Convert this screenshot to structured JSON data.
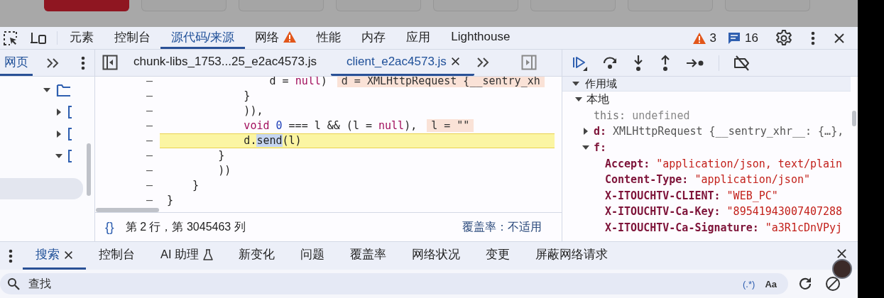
{
  "page_tabs": [
    {
      "selected": true
    },
    {
      "selected": false
    },
    {
      "selected": false
    },
    {
      "selected": false
    },
    {
      "selected": false
    },
    {
      "selected": false
    },
    {
      "selected": false
    },
    {
      "selected": false
    }
  ],
  "main_tabs": [
    {
      "label": "元素",
      "selected": false,
      "warning": false
    },
    {
      "label": "控制台",
      "selected": false,
      "warning": false
    },
    {
      "label": "源代码/来源",
      "selected": true,
      "warning": false
    },
    {
      "label": "网络",
      "selected": false,
      "warning": true
    },
    {
      "label": "性能",
      "selected": false,
      "warning": false
    },
    {
      "label": "内存",
      "selected": false,
      "warning": false
    },
    {
      "label": "应用",
      "selected": false,
      "warning": false
    },
    {
      "label": "Lighthouse",
      "selected": false,
      "warning": false
    }
  ],
  "issues": {
    "warnings": "3",
    "messages": "16"
  },
  "navigator": {
    "tabs": [
      {
        "label": "网页",
        "selected": true
      }
    ],
    "items": [
      {
        "kind": "folder",
        "expanded": true,
        "selected": false
      },
      {
        "kind": "frame",
        "expanded": false,
        "selected": false
      },
      {
        "kind": "frame",
        "expanded": false,
        "selected": false
      },
      {
        "kind": "frame",
        "expanded": true,
        "selected": false
      },
      {
        "kind": "blank",
        "selected": true
      }
    ]
  },
  "editor": {
    "tabs": [
      {
        "label": "chunk-libs_1753...25_e2ac4573.js",
        "selected": false,
        "closable": false
      },
      {
        "label": "client_e2ac4573.js",
        "selected": true,
        "closable": true
      }
    ],
    "lines": [
      {
        "gutter": "–",
        "paused": false,
        "tokens": [
          {
            "text": "                d = ",
            "kind": "plain"
          },
          {
            "text": "null",
            "kind": "keyword"
          },
          {
            "text": ")",
            "kind": "plain"
          }
        ],
        "inline_value": "d = XMLHttpRequest {__sentry_xh"
      },
      {
        "gutter": "–",
        "paused": false,
        "tokens": [
          {
            "text": "            }",
            "kind": "plain"
          }
        ]
      },
      {
        "gutter": "–",
        "paused": false,
        "tokens": [
          {
            "text": "            )),",
            "kind": "plain"
          }
        ]
      },
      {
        "gutter": "–",
        "paused": false,
        "tokens": [
          {
            "text": "            void",
            "kind": "keyword"
          },
          {
            "text": " 0",
            "kind": "number"
          },
          {
            "text": " === l && (l = ",
            "kind": "plain"
          },
          {
            "text": "null",
            "kind": "keyword"
          },
          {
            "text": "),",
            "kind": "plain"
          }
        ],
        "inline_value": "l = \"\""
      },
      {
        "gutter": "–",
        "paused": true,
        "tokens": [
          {
            "text": "            d.",
            "kind": "plain"
          },
          {
            "text": "send",
            "kind": "selection"
          },
          {
            "text": "(l)",
            "kind": "plain"
          }
        ]
      },
      {
        "gutter": "–",
        "paused": false,
        "tokens": [
          {
            "text": "        }",
            "kind": "plain"
          }
        ]
      },
      {
        "gutter": "–",
        "paused": false,
        "tokens": [
          {
            "text": "        ))",
            "kind": "plain"
          }
        ]
      },
      {
        "gutter": "–",
        "paused": false,
        "tokens": [
          {
            "text": "    }",
            "kind": "plain"
          }
        ]
      },
      {
        "gutter": "–",
        "paused": false,
        "tokens": [
          {
            "text": "}",
            "kind": "plain"
          }
        ]
      }
    ],
    "status": {
      "pretty_print": "{}",
      "position": "第 2 行，第 3045463 列",
      "coverage": "覆盖率：不适用"
    }
  },
  "scope": {
    "title": "作用域",
    "expanded": true,
    "groups": [
      {
        "name": "本地",
        "expanded": true,
        "items": [
          {
            "name": "this:",
            "value": "undefined",
            "kind": "undefined"
          },
          {
            "name": "d:",
            "value": "XMLHttpRequest {__sentry_xhr__: {…},",
            "kind": "object",
            "expanded": false
          },
          {
            "name": "f:",
            "kind": "object",
            "expanded": true,
            "children": [
              {
                "name": "Accept:",
                "value": "\"application/json, text/plain",
                "kind": "string"
              },
              {
                "name": "Content-Type:",
                "value": "\"application/json\"",
                "kind": "string"
              },
              {
                "name": "X-ITOUCHTV-CLIENT:",
                "value": "\"WEB_PC\"",
                "kind": "string"
              },
              {
                "name": "X-ITOUCHTV-Ca-Key:",
                "value": "\"89541943007407288",
                "kind": "string"
              },
              {
                "name": "X-ITOUCHTV-Ca-Signature:",
                "value": "\"a3R1cDnVPyj",
                "kind": "string"
              }
            ]
          }
        ]
      }
    ]
  },
  "drawer": {
    "tabs": [
      {
        "label": "搜索",
        "selected": true,
        "closable": true,
        "experimental": false
      },
      {
        "label": "控制台",
        "selected": false,
        "closable": false,
        "experimental": false
      },
      {
        "label": "AI 助理",
        "selected": false,
        "closable": false,
        "experimental": true
      },
      {
        "label": "新变化",
        "selected": false,
        "closable": false,
        "experimental": false
      },
      {
        "label": "问题",
        "selected": false,
        "closable": false,
        "experimental": false
      },
      {
        "label": "覆盖率",
        "selected": false,
        "closable": false,
        "experimental": false
      },
      {
        "label": "网络状况",
        "selected": false,
        "closable": false,
        "experimental": false
      },
      {
        "label": "变更",
        "selected": false,
        "closable": false,
        "experimental": false
      },
      {
        "label": "屏蔽网络请求",
        "selected": false,
        "closable": false,
        "experimental": false
      }
    ],
    "search": {
      "placeholder": "查找",
      "regex": "(.*)",
      "match_case": "Aa"
    }
  }
}
